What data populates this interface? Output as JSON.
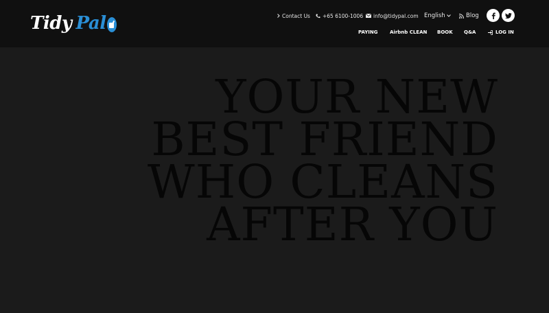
{
  "brand": {
    "name_part1": "Tidy",
    "name_part2": "Pal",
    "accent_color": "#2a8fd6",
    "icon": "mop-bucket-icon"
  },
  "topbar": {
    "contact_label": "Contact Us",
    "contact_icon": "chevron-right-icon",
    "phone": "+65 6100-1006",
    "phone_icon": "phone-icon",
    "email": "info@tidypal.com",
    "email_icon": "envelope-icon",
    "language": "English",
    "language_icon": "chevron-down-icon",
    "blog_label": "Blog",
    "blog_icon": "rss-icon"
  },
  "social": {
    "facebook_icon": "facebook-icon",
    "twitter_icon": "twitter-icon"
  },
  "nav": {
    "items": [
      "PAYING",
      "Airbnb CLEAN",
      "BOOK",
      "Q&A"
    ],
    "login_label": "LOG IN",
    "login_icon": "sign-in-icon"
  },
  "hero": {
    "lines": [
      "YOUR NEW",
      "BEST FRIEND",
      "WHO CLEANS",
      "AFTER YOU"
    ]
  },
  "colors": {
    "header_bg": "#101010",
    "page_bg": "#1b1b1b",
    "hero_text": "#060606"
  }
}
